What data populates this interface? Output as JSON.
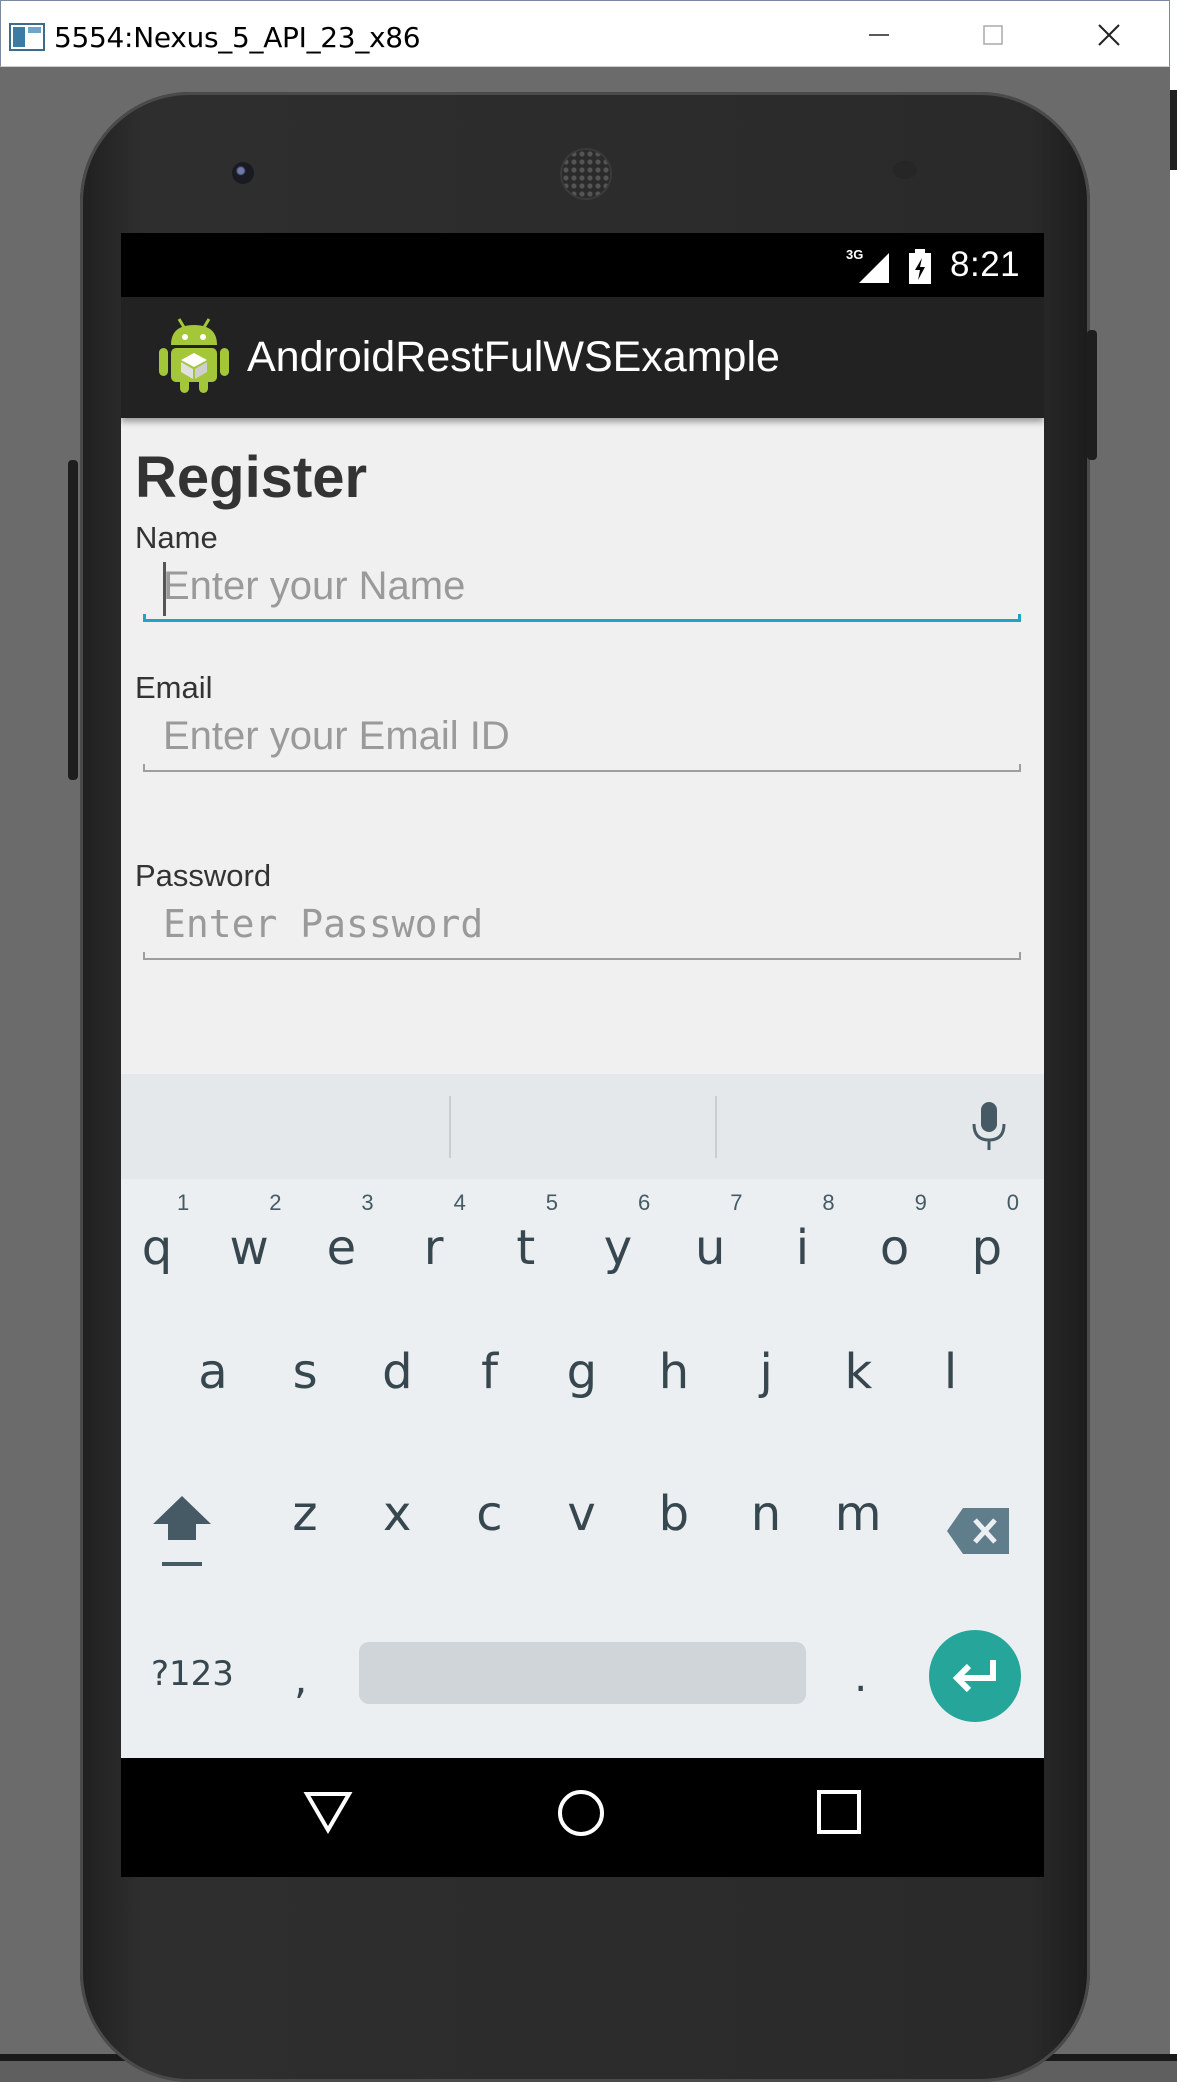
{
  "window": {
    "title": "5554:Nexus_5_API_23_x86",
    "minimize_glyph": "—",
    "maximize_glyph": "☐",
    "close_glyph": "✕"
  },
  "status_bar": {
    "network": "3G",
    "time": "8:21"
  },
  "action_bar": {
    "app_title": "AndroidRestFulWSExample",
    "icon": "android-robot-icon"
  },
  "form": {
    "heading": "Register",
    "name_label": "Name",
    "name_placeholder": "Enter your Name",
    "email_label": "Email",
    "email_placeholder": "Enter your Email ID",
    "password_label": "Password",
    "password_placeholder": "Enter Password"
  },
  "keyboard": {
    "row1": [
      {
        "key": "q",
        "num": "1"
      },
      {
        "key": "w",
        "num": "2"
      },
      {
        "key": "e",
        "num": "3"
      },
      {
        "key": "r",
        "num": "4"
      },
      {
        "key": "t",
        "num": "5"
      },
      {
        "key": "y",
        "num": "6"
      },
      {
        "key": "u",
        "num": "7"
      },
      {
        "key": "i",
        "num": "8"
      },
      {
        "key": "o",
        "num": "9"
      },
      {
        "key": "p",
        "num": "0"
      }
    ],
    "row2": [
      "a",
      "s",
      "d",
      "f",
      "g",
      "h",
      "j",
      "k",
      "l"
    ],
    "row3": [
      "z",
      "x",
      "c",
      "v",
      "b",
      "n",
      "m"
    ],
    "symbols_label": "?123",
    "comma_label": ",",
    "period_label": ".",
    "accent_color": "#26a69a"
  },
  "colors": {
    "focus_underline": "#26a1c6",
    "action_bar": "#222222"
  }
}
